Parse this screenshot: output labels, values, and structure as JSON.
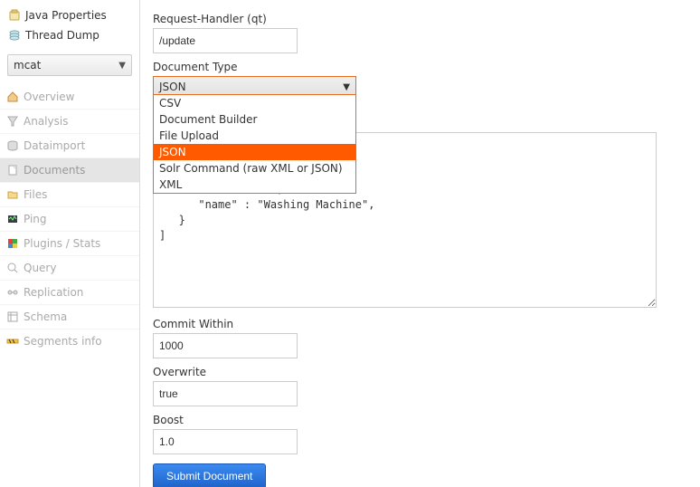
{
  "sidebar": {
    "top_links": [
      {
        "label": "Java Properties",
        "icon": "jar-icon"
      },
      {
        "label": "Thread Dump",
        "icon": "stack-icon"
      }
    ],
    "core_selected": "mcat",
    "nav_items": [
      {
        "label": "Overview",
        "icon": "house-icon",
        "selected": false
      },
      {
        "label": "Analysis",
        "icon": "funnel-icon",
        "selected": false
      },
      {
        "label": "Dataimport",
        "icon": "db-in-icon",
        "selected": false
      },
      {
        "label": "Documents",
        "icon": "doc-icon",
        "selected": true
      },
      {
        "label": "Files",
        "icon": "folder-icon",
        "selected": false
      },
      {
        "label": "Ping",
        "icon": "ping-icon",
        "selected": false
      },
      {
        "label": "Plugins / Stats",
        "icon": "puzzle-icon",
        "selected": false
      },
      {
        "label": "Query",
        "icon": "magnifier-icon",
        "selected": false
      },
      {
        "label": "Replication",
        "icon": "replication-icon",
        "selected": false
      },
      {
        "label": "Schema",
        "icon": "schema-icon",
        "selected": false
      },
      {
        "label": "Segments info",
        "icon": "barrier-icon",
        "selected": false
      }
    ]
  },
  "form": {
    "request_handler": {
      "label": "Request-Handler (qt)",
      "value": "/update"
    },
    "doc_type": {
      "label": "Document Type",
      "selected": "JSON",
      "options": [
        "CSV",
        "Document Builder",
        "File Upload",
        "JSON",
        "Solr Command (raw XML or JSON)",
        "XML"
      ]
    },
    "document_body": "      \"name\" : \"Led TV\",\n   },\n   {\n      \"id\" : \"001\",\n      \"name\" : \"Washing Machine\",\n   }\n]",
    "commit_within": {
      "label": "Commit Within",
      "value": "1000"
    },
    "overwrite": {
      "label": "Overwrite",
      "value": "true"
    },
    "boost": {
      "label": "Boost",
      "value": "1.0"
    },
    "submit_label": "Submit Document"
  }
}
